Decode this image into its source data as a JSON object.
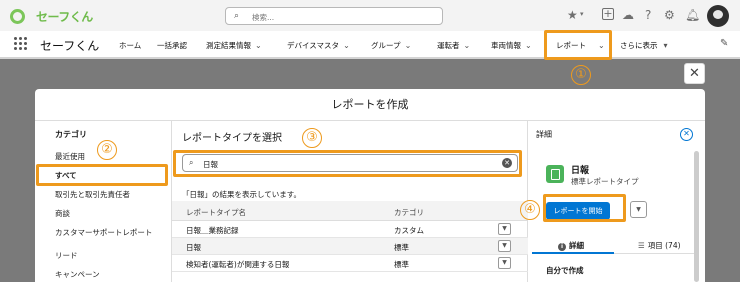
{
  "header": {
    "logo_text": "セーフくん",
    "search_placeholder": "検索...",
    "icons": [
      "star-icon",
      "plus-icon",
      "cloud-icon",
      "help-icon",
      "gear-icon",
      "bell-icon",
      "avatar"
    ]
  },
  "navbar": {
    "app_name": "セーフくん",
    "items": [
      {
        "label": "ホーム",
        "dropdown": false
      },
      {
        "label": "一括承認",
        "dropdown": false
      },
      {
        "label": "測定結果情報",
        "dropdown": true
      },
      {
        "label": "デバイスマスタ",
        "dropdown": true
      },
      {
        "label": "グループ",
        "dropdown": true
      },
      {
        "label": "運転者",
        "dropdown": true
      },
      {
        "label": "車両情報",
        "dropdown": true
      },
      {
        "label": "レポート",
        "dropdown": true
      },
      {
        "label": "さらに表示",
        "dropdown": true
      }
    ]
  },
  "callouts": [
    "①",
    "②",
    "③",
    "④"
  ],
  "accent_color": "#ee9a1d",
  "brand_color": "#0176d3",
  "modal": {
    "title": "レポートを作成",
    "close_label": "✕",
    "categories": {
      "title": "カテゴリ",
      "items": [
        "最近使用",
        "すべて",
        "取引先と取引先責任者",
        "商談",
        "カスタマーサポートレポート",
        "リード",
        "キャンペーン"
      ],
      "selected": "すべて"
    },
    "report_types": {
      "title": "レポートタイプを選択",
      "search_value": "日報",
      "result_message": "「日報」の結果を表示しています。",
      "columns": [
        "レポートタイプ名",
        "カテゴリ"
      ],
      "rows": [
        {
          "name": "日報＿業務記録",
          "category": "カスタム"
        },
        {
          "name": "日報",
          "category": "標準"
        },
        {
          "name": "検知者(運転者)が関連する日報",
          "category": "標準"
        }
      ]
    },
    "details": {
      "title": "詳細",
      "report_name": "日報",
      "report_type": "標準レポートタイプ",
      "start_button": "レポートを開始",
      "tabs": [
        {
          "label": "詳細",
          "icon": "info-icon",
          "active": true
        },
        {
          "label": "項目 (74)",
          "icon": "list-icon",
          "active": false
        }
      ],
      "created_by": "自分で作成"
    }
  }
}
